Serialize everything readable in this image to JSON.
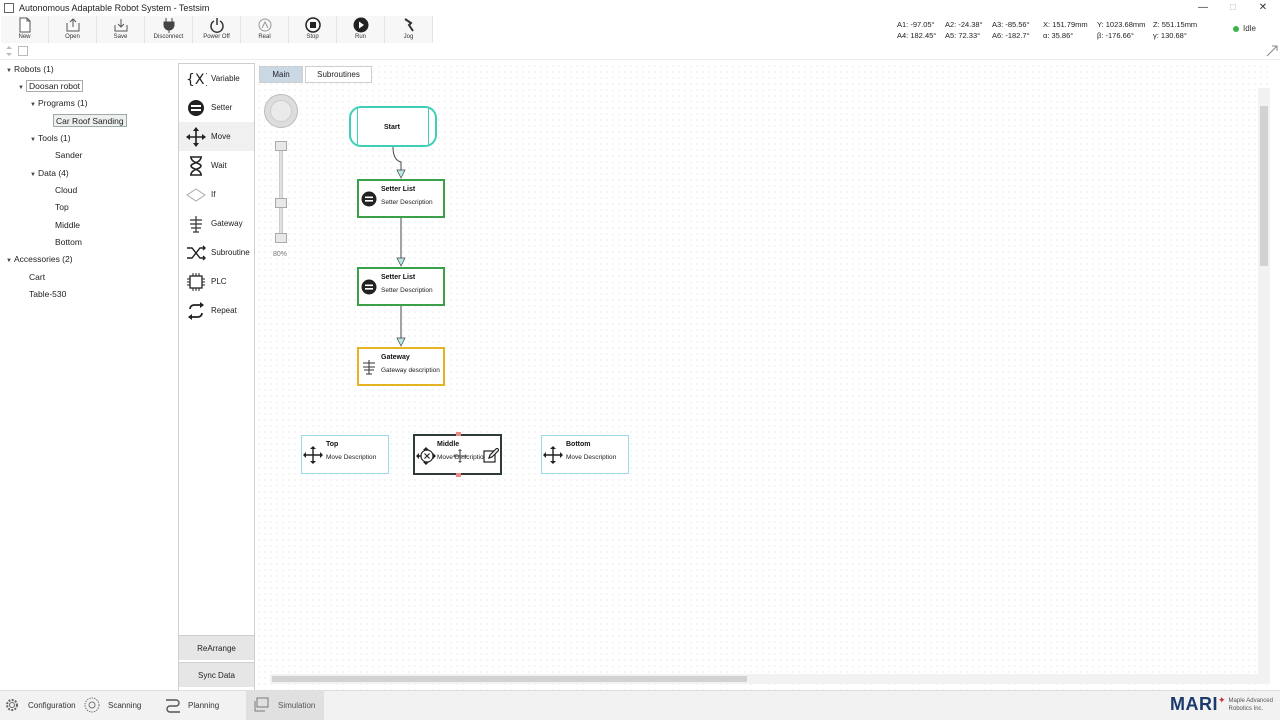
{
  "window": {
    "title": "Autonomous Adaptable Robot System - Testsim",
    "controls": [
      "—",
      "□",
      "✕"
    ]
  },
  "toolbar": {
    "buttons": [
      {
        "label": "New",
        "icon": "new-file-icon"
      },
      {
        "label": "Open",
        "icon": "open-icon"
      },
      {
        "label": "Save",
        "icon": "save-icon"
      },
      {
        "label": "Disconnect",
        "icon": "plug-icon"
      },
      {
        "label": "Power Off",
        "icon": "power-icon"
      },
      {
        "label": "Real",
        "icon": "robot-real-icon"
      },
      {
        "label": "Stop",
        "icon": "stop-icon"
      },
      {
        "label": "Run",
        "icon": "play-icon"
      },
      {
        "label": "Jog",
        "icon": "jog-icon"
      }
    ]
  },
  "readouts": {
    "a1": "A1: -97.05°",
    "a2": "A2: -24.38°",
    "a3": "A3: -85.56°",
    "a4": "A4: 182.45°",
    "a5": "A5: 72.33°",
    "a6": "A6: -182.7°",
    "x": "X: 151.79mm",
    "y": "Y: 1023.68mm",
    "z": "Z: 551.15mm",
    "alpha": "α: 35.86°",
    "beta": "β: -176.66°",
    "gamma": "γ: 130.68°"
  },
  "status": {
    "text": "Idle",
    "color": "#3bb54a"
  },
  "tree": {
    "robots": "Robots (1)",
    "robot": "Doosan robot",
    "programs": "Programs (1)",
    "program": "Car Roof Sanding",
    "tools": "Tools (1)",
    "tool": "Sander",
    "data": "Data (4)",
    "data_items": [
      "Cloud",
      "Top",
      "Middle",
      "Bottom"
    ],
    "accessories": "Accessories (2)",
    "accessory_items": [
      "Cart",
      "Table-530"
    ]
  },
  "palette": {
    "items": [
      {
        "label": "Variable",
        "icon": "variable-icon"
      },
      {
        "label": "Setter",
        "icon": "setter-icon"
      },
      {
        "label": "Move",
        "icon": "move-icon"
      },
      {
        "label": "Wait",
        "icon": "hourglass-icon"
      },
      {
        "label": "If",
        "icon": "diamond-icon"
      },
      {
        "label": "Gateway",
        "icon": "gateway-icon"
      },
      {
        "label": "Subroutine",
        "icon": "shuffle-icon"
      },
      {
        "label": "PLC",
        "icon": "chip-icon"
      },
      {
        "label": "Repeat",
        "icon": "repeat-icon"
      }
    ],
    "rearrange": "ReArrange",
    "sync": "Sync Data"
  },
  "tabs": {
    "main": "Main",
    "subroutines": "Subroutines"
  },
  "zoom": {
    "label": "80%",
    "value_percent": 80
  },
  "flow": {
    "start": "Start",
    "setter1": {
      "title": "Setter List",
      "desc": "Setter Description"
    },
    "setter2": {
      "title": "Setter List",
      "desc": "Setter Description"
    },
    "gateway": {
      "title": "Gateway",
      "desc": "Gateway description"
    },
    "move_top": {
      "title": "Top",
      "desc": "Move Description"
    },
    "move_middle": {
      "title": "Middle",
      "desc": "Move Description"
    },
    "move_bottom": {
      "title": "Bottom",
      "desc": "Move Description"
    }
  },
  "colors": {
    "start": "#3fcfb8",
    "setter": "#3aa04a",
    "gateway": "#e6b422",
    "move": "#9fd8e8",
    "move_selected": "#2f3a3a"
  },
  "bottom_nav": [
    {
      "label": "Configuration",
      "icon": "gear-icon"
    },
    {
      "label": "Scanning",
      "icon": "scan-icon"
    },
    {
      "label": "Planning",
      "icon": "path-icon"
    },
    {
      "label": "Simulation",
      "icon": "simulation-icon"
    }
  ],
  "brand": {
    "logo": "MARI",
    "line1": "Maple Advanced",
    "line2": "Robotics Inc."
  }
}
